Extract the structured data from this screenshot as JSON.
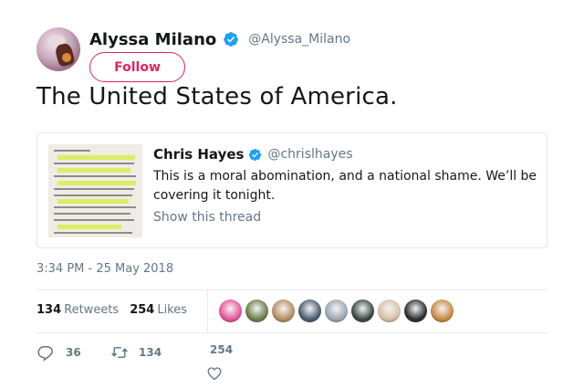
{
  "author": {
    "display_name": "Alyssa Milano",
    "handle": "@Alyssa_Milano",
    "verified": true
  },
  "follow_button": {
    "label": "Follow"
  },
  "tweet": {
    "text": "The United States of America.",
    "timestamp": "3:34 PM - 25 May 2018"
  },
  "quoted_tweet": {
    "display_name": "Chris Hayes",
    "handle": "@chrislhayes",
    "verified": true,
    "text": "This is a moral abomination, and a national shame. We’ll be covering it tonight.",
    "show_thread": "Show this thread"
  },
  "stats": {
    "retweets_count": "134",
    "retweets_label": "Retweets",
    "likes_count": "254",
    "likes_label": "Likes"
  },
  "actions": {
    "reply_count": "36",
    "retweet_count": "134",
    "like_count": "254"
  },
  "likers": [
    {
      "name": "liker-avatar-1",
      "color": "#e4569a"
    },
    {
      "name": "liker-avatar-2",
      "color": "#6c7f4a"
    },
    {
      "name": "liker-avatar-3",
      "color": "#b78d62"
    },
    {
      "name": "liker-avatar-4",
      "color": "#4d5c70"
    },
    {
      "name": "liker-avatar-5",
      "color": "#9aa7b2"
    },
    {
      "name": "liker-avatar-6",
      "color": "#3b4a43"
    },
    {
      "name": "liker-avatar-7",
      "color": "#d8c1a5"
    },
    {
      "name": "liker-avatar-8",
      "color": "#2f2f2f"
    },
    {
      "name": "liker-avatar-9",
      "color": "#c78a45"
    }
  ],
  "colors": {
    "accent": "#e0245e",
    "verified": "#1da1f2",
    "muted_text": "#657786",
    "text": "#14171a"
  }
}
